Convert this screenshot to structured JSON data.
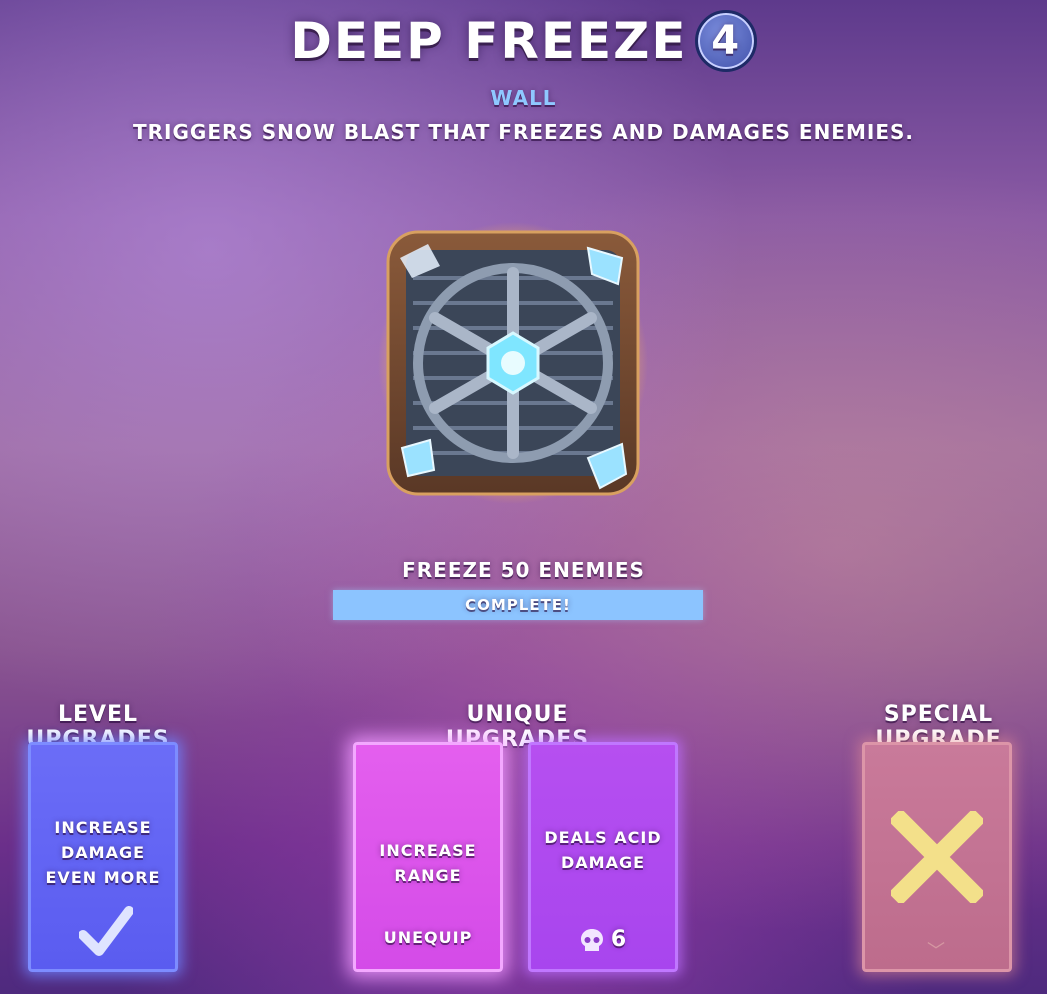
{
  "header": {
    "trap_name": "Deep Freeze",
    "level": "4",
    "category": "Wall",
    "description": "Triggers snow blast that freezes and damages enemies."
  },
  "challenge": {
    "title": "Freeze 50 Enemies",
    "status": "Complete!",
    "progress": 1.0
  },
  "sections": {
    "level": "Level Upgrades",
    "unique": "Unique Upgrades",
    "special": "Special Upgrade"
  },
  "cards": {
    "level_upgrade": {
      "text": "Increase Damage Even More",
      "state_icon": "checkmark-icon"
    },
    "unique_1": {
      "text": "Increase Range",
      "action": "Unequip"
    },
    "unique_2": {
      "text": "Deals Acid Damage",
      "cost": "6",
      "cost_icon": "skull-icon"
    },
    "special": {
      "state_icon": "x-mark-icon"
    }
  },
  "colors": {
    "level_card": "#6b6df7",
    "unique_equipped": "#e45fee",
    "unique_available": "#b64ff0",
    "special_locked": "#c97a9a",
    "progress_bar": "#82beff",
    "category_text": "#8fc8ff"
  }
}
